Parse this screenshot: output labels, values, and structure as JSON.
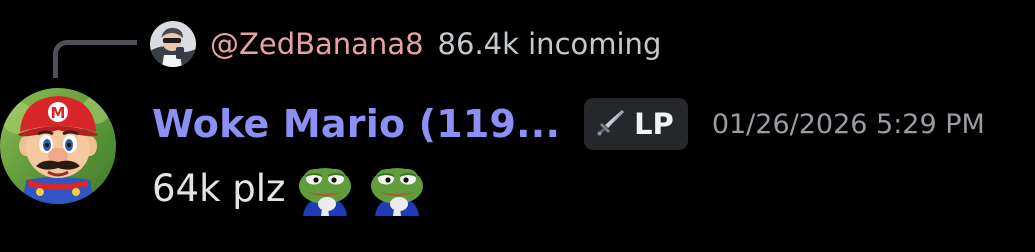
{
  "reply": {
    "author": "@ZedBanana8",
    "content": "86.4k incoming"
  },
  "message": {
    "username": "Woke Mario (119...",
    "tag": {
      "label": "LP",
      "icon": "sword-icon"
    },
    "timestamp": "01/26/2026 5:29 PM",
    "content": "64k plz",
    "emojis": [
      "pepe-emoji",
      "pepe-emoji"
    ]
  },
  "colors": {
    "background": "#000000",
    "username": "#8c8ff5",
    "reply_author": "#e8a2a6",
    "timestamp": "#9a9ca3",
    "tag_background": "#25272b",
    "reply_spine": "#4e5058"
  }
}
